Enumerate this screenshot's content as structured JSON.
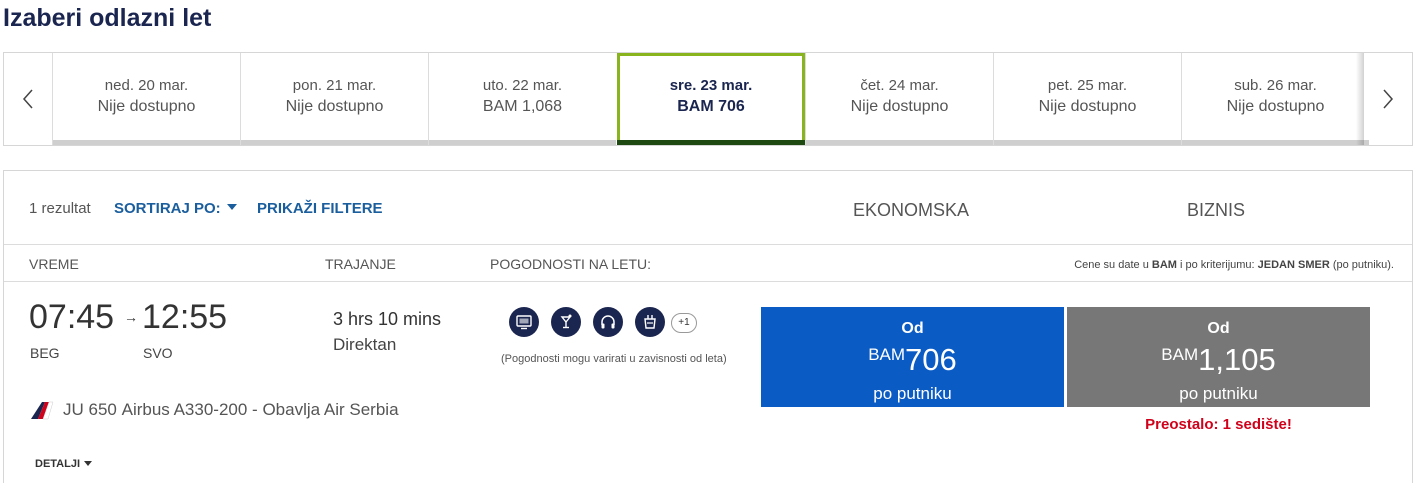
{
  "page": {
    "title": "Izaberi odlazni let"
  },
  "date_strip": {
    "prev_icon": "chevron-left-icon",
    "next_icon": "chevron-right-icon",
    "dates": [
      {
        "label": "ned. 20 mar.",
        "price": "Nije dostupno",
        "selected": false
      },
      {
        "label": "pon. 21 mar.",
        "price": "Nije dostupno",
        "selected": false
      },
      {
        "label": "uto. 22 mar.",
        "price": "BAM 1,068",
        "selected": false
      },
      {
        "label": "sre. 23 mar.",
        "price": "BAM 706",
        "selected": true
      },
      {
        "label": "čet. 24 mar.",
        "price": "Nije dostupno",
        "selected": false
      },
      {
        "label": "pet. 25 mar.",
        "price": "Nije dostupno",
        "selected": false
      },
      {
        "label": "sub. 26 mar.",
        "price": "Nije dostupno",
        "selected": false
      }
    ],
    "colors": {
      "selected_border": "#8ab41e",
      "selected_bar": "#1e4a12",
      "bar": "#cfcfcf"
    }
  },
  "toolbar": {
    "count": "1 rezultat",
    "sort_label": "SORTIRAJ PO:",
    "filter_label": "PRIKAŽI FILTERE",
    "cabin_economy": "EKONOMSKA",
    "cabin_business": "BIZNIS"
  },
  "columns": {
    "time": "VREME",
    "duration": "TRAJANJE",
    "amenities": "POGODNOSTI NA LETU:",
    "price_note": {
      "prefix": "Cene su date u",
      "currency": "BAM",
      "middle": "i po kriterijumu:",
      "criterion": "JEDAN SMER",
      "suffix": "(po putniku)."
    }
  },
  "flight": {
    "departure_time": "07:45",
    "arrow": "→",
    "arrival_time": "12:55",
    "departure_airport": "BEG",
    "arrival_airport": "SVO",
    "duration": "3 hrs 10 mins",
    "stops": "Direktan",
    "amenities": [
      "entertainment-screen-icon",
      "drink-icon",
      "headphones-icon",
      "meal-icon"
    ],
    "amenities_more": "+1",
    "amenities_note": "(Pogodnosti mogu varirati u zavisnosti od leta)",
    "flight_number": "JU 650",
    "aircraft": "Airbus A330-200",
    "separator": "-",
    "operated_by": "Obavlja Air Serbia",
    "details_label": "DETALJI"
  },
  "fares": {
    "economy": {
      "from": "Od",
      "currency": "BAM",
      "price": "706",
      "per": "po putniku",
      "color": "#0a5bc4"
    },
    "business": {
      "from": "Od",
      "currency": "BAM",
      "price": "1,105",
      "per": "po putniku",
      "color": "#777777",
      "seats_left": "Preostalo: 1 sedište!",
      "alert_color": "#d0021b"
    }
  }
}
